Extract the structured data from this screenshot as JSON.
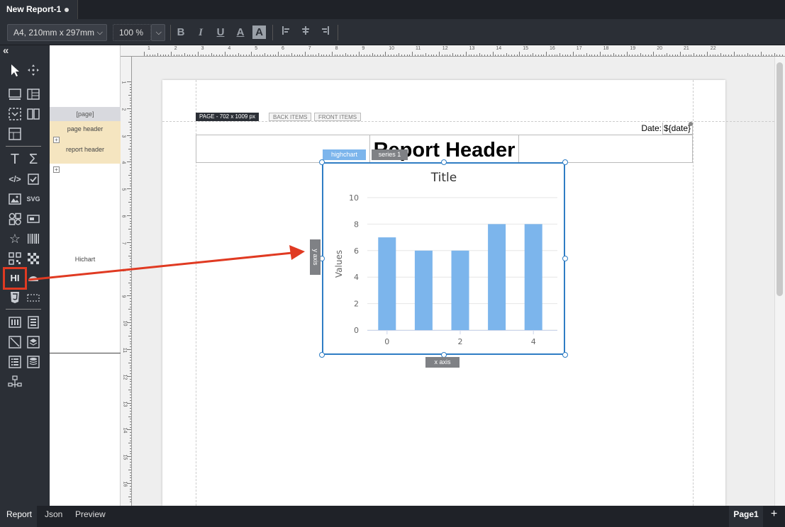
{
  "tab": {
    "title": "New Report-1"
  },
  "toolbar": {
    "paper_size": "A4, 210mm x 297mm",
    "zoom": "100 %",
    "bold": "B",
    "italic": "I",
    "underline": "U",
    "font_color": "A",
    "back_color": "A"
  },
  "palette": {
    "collapse": "«",
    "svg_label": "SVG",
    "hichart_label": "HI",
    "sigma": "Σ",
    "text": "T",
    "code": "</>"
  },
  "bands": {
    "page": "[page]",
    "page_header": "page header",
    "report_header": "report header",
    "hichart": "Hichart",
    "expand": "+"
  },
  "ruler": {
    "top": [
      "1",
      "2",
      "3",
      "4",
      "5",
      "6",
      "7",
      "8",
      "9",
      "10",
      "11",
      "12",
      "13",
      "14",
      "15",
      "16",
      "17",
      "18",
      "19",
      "20",
      "21",
      "22"
    ],
    "left": [
      "1",
      "2",
      "3",
      "4",
      "5",
      "6",
      "7",
      "8",
      "9",
      "10",
      "11",
      "12",
      "13",
      "14",
      "15",
      "16"
    ]
  },
  "page_tabs": {
    "page": "PAGE - 702 x 1009 px",
    "back": "BACK ITEMS",
    "front": "FRONT ITEMS"
  },
  "report": {
    "date_label": "Date:",
    "date_value": "${date}",
    "header_text": "Report Header"
  },
  "chart_tags": {
    "highchart": "highchart",
    "series": "series 1",
    "y_axis": "y axis",
    "x_axis": "x axis"
  },
  "chart_data": {
    "type": "bar",
    "title": "Title",
    "ylabel": "Values",
    "xlabel": "",
    "x": [
      0,
      1,
      2,
      3,
      4
    ],
    "x_tick_labels": [
      "0",
      "2",
      "4"
    ],
    "x_tick_values": [
      0,
      2,
      4
    ],
    "y_ticks": [
      "0",
      "2",
      "4",
      "6",
      "8",
      "10"
    ],
    "values": [
      7,
      6,
      6,
      8,
      8
    ],
    "ylim": [
      0,
      10
    ],
    "bar_color": "#7cb5ec",
    "grid": true
  },
  "colors": {
    "accent_blue": "#2f7dc4",
    "highlight_red": "#e03a22",
    "highchart_tag": "#7cb5ec",
    "series_tag": "#7f8185"
  },
  "bottom": {
    "tabs": [
      "Report",
      "Json",
      "Preview"
    ],
    "page": "Page1",
    "add": "+"
  }
}
